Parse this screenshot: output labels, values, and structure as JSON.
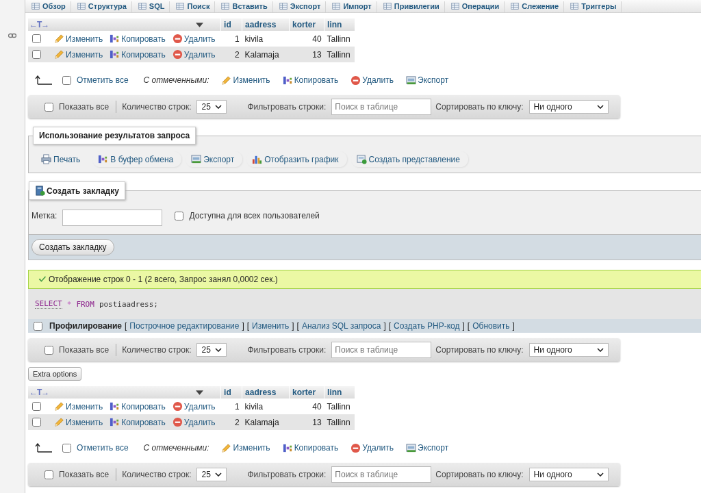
{
  "tabs": [
    {
      "label": "Обзор"
    },
    {
      "label": "Структура"
    },
    {
      "label": "SQL"
    },
    {
      "label": "Поиск"
    },
    {
      "label": "Вставить"
    },
    {
      "label": "Экспорт"
    },
    {
      "label": "Импорт"
    },
    {
      "label": "Привилегии"
    },
    {
      "label": "Операции"
    },
    {
      "label": "Слежение"
    },
    {
      "label": "Триггеры"
    }
  ],
  "sections": [
    {
      "kind": "table",
      "header_arrows": "←T→",
      "columns": [
        {
          "label": "id"
        },
        {
          "label": "aadress"
        },
        {
          "label": "korter"
        },
        {
          "label": "linn"
        }
      ],
      "rows": [
        {
          "checked": false,
          "actions": [
            {
              "kind": "edit",
              "label": "Изменить"
            },
            {
              "kind": "copy",
              "label": "Копировать"
            },
            {
              "kind": "delete",
              "label": "Удалить"
            }
          ],
          "cells": [
            "1",
            "kivila",
            "40",
            "Tallinn"
          ]
        },
        {
          "checked": false,
          "actions": [
            {
              "kind": "edit",
              "label": "Изменить"
            },
            {
              "kind": "copy",
              "label": "Копировать"
            },
            {
              "kind": "delete",
              "label": "Удалить"
            }
          ],
          "cells": [
            "2",
            "Kalamaja",
            "13",
            "Tallinn"
          ]
        }
      ]
    },
    {
      "kind": "bulk",
      "check_all": {
        "label": "Отметить все",
        "checked": false
      },
      "with_selected": "С отмеченными:",
      "actions": [
        {
          "kind": "edit",
          "label": "Изменить"
        },
        {
          "kind": "copy",
          "label": "Копировать"
        },
        {
          "kind": "delete",
          "label": "Удалить"
        },
        {
          "kind": "export",
          "label": "Экспорт"
        }
      ]
    },
    {
      "kind": "nav",
      "show_all": {
        "label": "Показать все",
        "checked": false
      },
      "rows_label": "Количество строк:",
      "rows_value": "25",
      "filter_label": "Фильтровать строки:",
      "filter_placeholder": "Поиск в таблице",
      "sort_label": "Сортировать по ключу:",
      "sort_value": "Ни одного"
    },
    {
      "kind": "query_ops",
      "legend": "Использование результатов запроса",
      "buttons": [
        {
          "kind": "print",
          "label": "Печать"
        },
        {
          "kind": "copy",
          "label": "В буфер обмена"
        },
        {
          "kind": "export",
          "label": "Экспорт"
        },
        {
          "kind": "chart",
          "label": "Отобразить график"
        },
        {
          "kind": "view",
          "label": "Создать представление"
        }
      ]
    },
    {
      "kind": "bookmark",
      "legend": "Создать закладку",
      "label_text": "Метка:",
      "shared": {
        "label": "Доступна для всех пользователей",
        "checked": false
      },
      "submit": "Создать закладку"
    },
    {
      "kind": "message",
      "text": "Отображение строк 0 - 1 (2 всего, Запрос занял 0,0002 сек.)"
    },
    {
      "kind": "sql",
      "tokens": [
        {
          "kind": "keyword",
          "text": "SELECT"
        },
        {
          "kind": "operator",
          "text": "*"
        },
        {
          "kind": "keyword",
          "text": "FROM"
        },
        {
          "kind": "plain",
          "text": "postiaadress;"
        }
      ]
    },
    {
      "kind": "profiling",
      "checkbox": {
        "label": "Профилирование",
        "checked": false
      },
      "bracket_open": "[",
      "bracket_close": "]",
      "links": [
        {
          "label": "Построчное редактирование"
        },
        {
          "label": "Изменить"
        },
        {
          "label": "Анализ SQL запроса"
        },
        {
          "label": "Создать PHP-код"
        },
        {
          "label": "Обновить"
        }
      ]
    },
    {
      "kind": "nav",
      "show_all": {
        "label": "Показать все",
        "checked": false
      },
      "rows_label": "Количество строк:",
      "rows_value": "25",
      "filter_label": "Фильтровать строки:",
      "filter_placeholder": "Поиск в таблице",
      "sort_label": "Сортировать по ключу:",
      "sort_value": "Ни одного"
    },
    {
      "kind": "extra",
      "label": "Extra options"
    },
    {
      "kind": "table",
      "header_arrows": "←T→",
      "columns": [
        {
          "label": "id"
        },
        {
          "label": "aadress"
        },
        {
          "label": "korter"
        },
        {
          "label": "linn"
        }
      ],
      "rows": [
        {
          "checked": false,
          "actions": [
            {
              "kind": "edit",
              "label": "Изменить"
            },
            {
              "kind": "copy",
              "label": "Копировать"
            },
            {
              "kind": "delete",
              "label": "Удалить"
            }
          ],
          "cells": [
            "1",
            "kivila",
            "40",
            "Tallinn"
          ]
        },
        {
          "checked": false,
          "actions": [
            {
              "kind": "edit",
              "label": "Изменить"
            },
            {
              "kind": "copy",
              "label": "Копировать"
            },
            {
              "kind": "delete",
              "label": "Удалить"
            }
          ],
          "cells": [
            "2",
            "Kalamaja",
            "13",
            "Tallinn"
          ]
        }
      ]
    },
    {
      "kind": "bulk",
      "check_all": {
        "label": "Отметить все",
        "checked": false
      },
      "with_selected": "С отмеченными:",
      "actions": [
        {
          "kind": "edit",
          "label": "Изменить"
        },
        {
          "kind": "copy",
          "label": "Копировать"
        },
        {
          "kind": "delete",
          "label": "Удалить"
        },
        {
          "kind": "export",
          "label": "Экспорт"
        }
      ]
    },
    {
      "kind": "nav",
      "show_all": {
        "label": "Показать все",
        "checked": false
      },
      "rows_label": "Количество строк:",
      "rows_value": "25",
      "filter_label": "Фильтровать строки:",
      "filter_placeholder": "Поиск в таблице",
      "sort_label": "Сортировать по ключу:",
      "sort_value": "Ни одного"
    }
  ]
}
